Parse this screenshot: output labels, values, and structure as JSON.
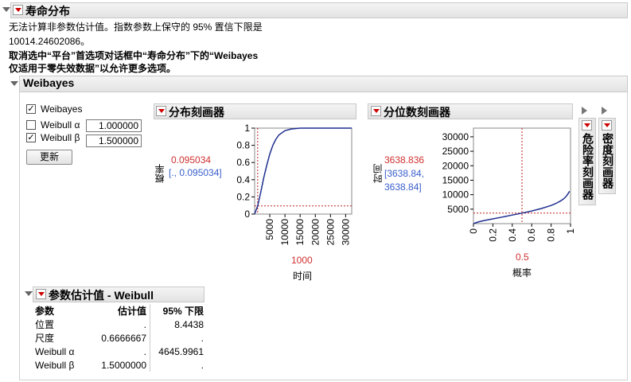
{
  "life_distribution": {
    "title": "寿命分布",
    "message_line1": "无法计算非参数估计值。指数参数上保守的 95% 置信下限是",
    "message_line2": "10014.24602086。",
    "message_bold_line1": "取消选中“平台”首选项对话框中“寿命分布”下的“Weibayes",
    "message_bold_line2": "仅适用于零失效数据”以允许更多选项。"
  },
  "weibayes": {
    "title": "Weibayes",
    "controls": {
      "weibayes_label": "Weibayes",
      "weibayes_checked": true,
      "alpha_label": "Weibull α",
      "alpha_checked": false,
      "alpha_value": "1.000000",
      "beta_label": "Weibull β",
      "beta_checked": true,
      "beta_value": "1.500000",
      "update_button": "更新"
    },
    "dist_profiler": {
      "title": "分布刻画器",
      "ylabel": "概率",
      "xlabel": "时间",
      "current_value": "0.095034",
      "current_interval": "[., 0.095034]",
      "current_x": "1000"
    },
    "quantile_profiler": {
      "title": "分位数刻画器",
      "ylabel": "时间",
      "xlabel": "概率",
      "current_value": "3638.836",
      "current_interval_line1": "[3638.84,",
      "current_interval_line2": "3638.84]",
      "current_x": "0.5"
    },
    "hazard_profiler": {
      "title": "危险率刻画器"
    },
    "density_profiler": {
      "title": "密度刻画器"
    },
    "param_estimates": {
      "title": "参数估计值 - Weibull",
      "headers": [
        "参数",
        "估计值",
        "95% 下限"
      ],
      "rows": [
        [
          "位置",
          ".",
          "8.4438"
        ],
        [
          "尺度",
          "0.6666667",
          "."
        ],
        [
          "Weibull α",
          ".",
          "4645.9961"
        ],
        [
          "Weibull β",
          "1.5000000",
          "."
        ]
      ]
    }
  },
  "colors": {
    "curve": "#1f2f8f",
    "crosshair": "#c02020",
    "current_value": "#d03030",
    "interval": "#3a5fcd"
  },
  "chart_data": [
    {
      "type": "line",
      "title": "分布刻画器",
      "xlabel": "时间",
      "ylabel": "概率",
      "xlim": [
        0,
        32000
      ],
      "ylim": [
        0,
        1.0
      ],
      "xticks": [
        5000,
        10000,
        15000,
        20000,
        25000,
        30000
      ],
      "yticks": [
        0,
        0.2,
        0.4,
        0.6,
        0.8,
        1
      ],
      "x": [
        0,
        1000,
        2000,
        3000,
        4000,
        5000,
        6000,
        7000,
        8000,
        10000,
        12000,
        15000,
        20000,
        25000,
        30000,
        32000
      ],
      "y": [
        0,
        0.095,
        0.25,
        0.42,
        0.57,
        0.7,
        0.8,
        0.87,
        0.92,
        0.97,
        0.99,
        1.0,
        1.0,
        1.0,
        1.0,
        1.0
      ],
      "crosshair": {
        "x": 1000,
        "y": 0.095034
      }
    },
    {
      "type": "line",
      "title": "分位数刻画器",
      "xlabel": "概率",
      "ylabel": "时间",
      "xlim": [
        0,
        1
      ],
      "ylim": [
        0,
        33000
      ],
      "xticks": [
        0,
        0.2,
        0.4,
        0.6,
        0.8,
        1
      ],
      "yticks": [
        5000,
        10000,
        15000,
        20000,
        25000,
        30000
      ],
      "x": [
        0.0,
        0.05,
        0.1,
        0.2,
        0.3,
        0.4,
        0.5,
        0.6,
        0.7,
        0.8,
        0.85,
        0.9,
        0.93,
        0.95,
        0.97,
        0.99
      ],
      "y": [
        10,
        580,
        1000,
        1640,
        2290,
        2980,
        3640,
        4360,
        5220,
        6280,
        6990,
        7890,
        8600,
        9240,
        10100,
        11200
      ],
      "crosshair": {
        "x": 0.5,
        "y": 3638.836
      }
    }
  ]
}
